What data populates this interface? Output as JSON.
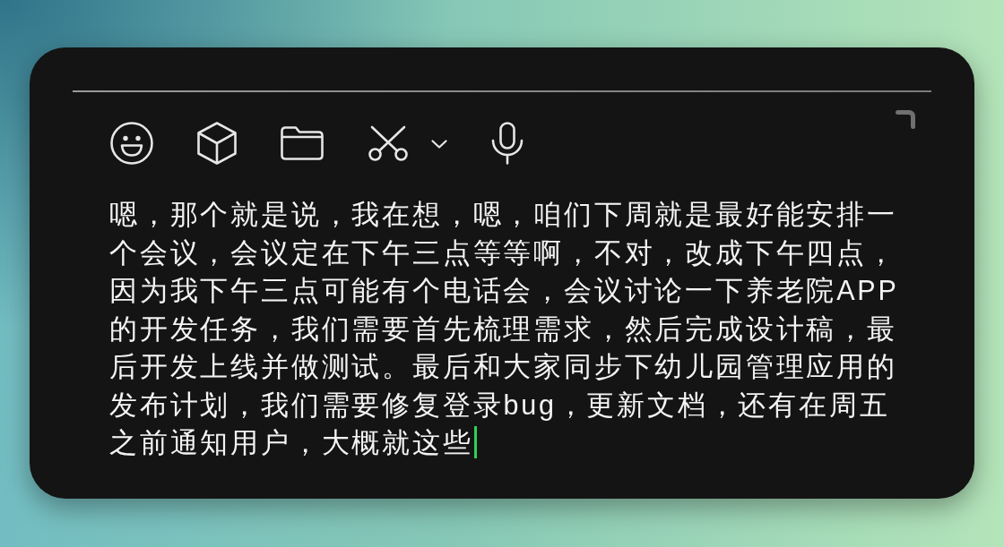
{
  "editor": {
    "text": "嗯，那个就是说，我在想，嗯，咱们下周就是最好能安排一个会议，会议定在下午三点等等啊，不对，改成下午四点，因为我下午三点可能有个电话会，会议讨论一下养老院APP的开发任务，我们需要首先梳理需求，然后完成设计稿，最后开发上线并做测试。最后和大家同步下幼儿园管理应用的发布计划，我们需要修复登录bug，更新文档，还有在周五之前通知用户，大概就这些"
  }
}
